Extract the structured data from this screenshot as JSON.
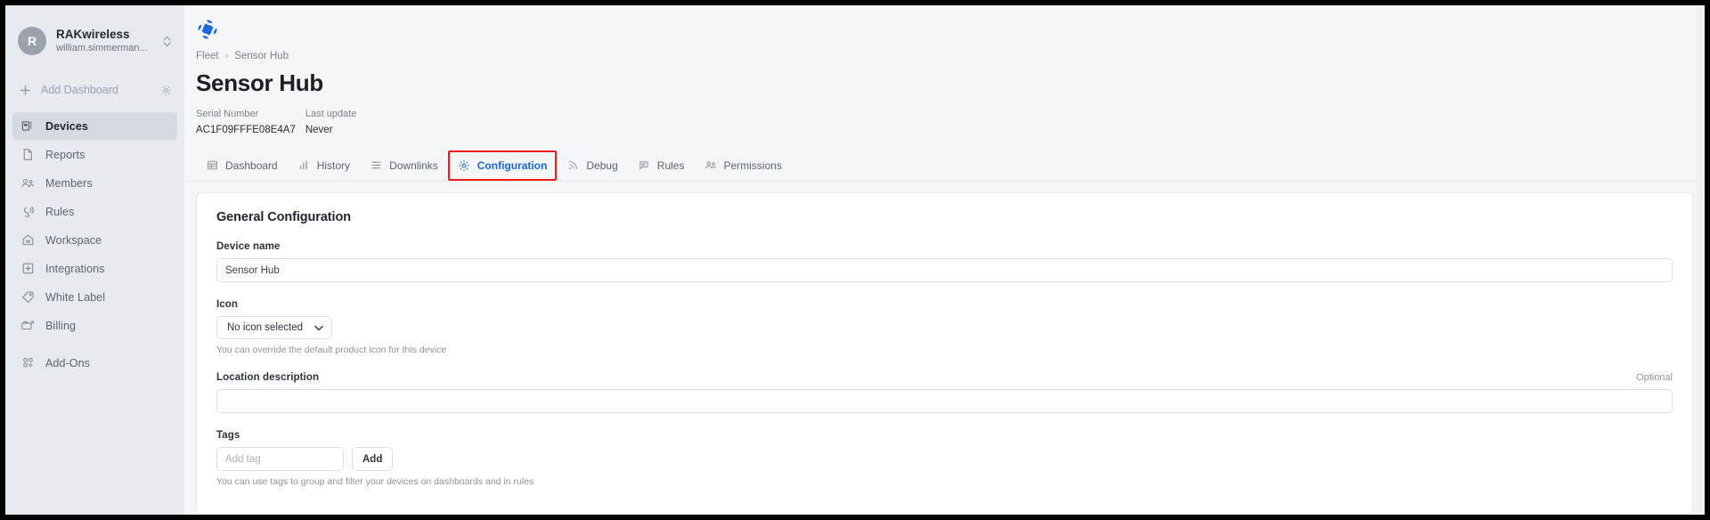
{
  "sidebar": {
    "account": {
      "avatar_initial": "R",
      "org_name": "RAKwireless",
      "user_email": "william.simmerman...",
      "switcher_icon": "chevron-up-down-icon"
    },
    "add_dashboard": {
      "label": "Add Dashboard",
      "plus_icon": "plus-icon",
      "settings_icon": "gear-icon"
    },
    "items": [
      {
        "label": "Devices",
        "icon": "devices-icon",
        "active": true
      },
      {
        "label": "Reports",
        "icon": "document-icon",
        "active": false
      },
      {
        "label": "Members",
        "icon": "users-icon",
        "active": false
      },
      {
        "label": "Rules",
        "icon": "broadcast-icon",
        "active": false
      },
      {
        "label": "Workspace",
        "icon": "home-icon",
        "active": false
      },
      {
        "label": "Integrations",
        "icon": "plus-square-icon",
        "active": false
      },
      {
        "label": "White Label",
        "icon": "tag-icon",
        "active": false
      },
      {
        "label": "Billing",
        "icon": "billing-icon",
        "active": false
      },
      {
        "label": "Add-Ons",
        "icon": "addons-icon",
        "active": false
      }
    ]
  },
  "header": {
    "logo_icon": "rakwireless-logo-icon",
    "breadcrumb": {
      "root": "Fleet",
      "separator": "›",
      "current": "Sensor Hub"
    },
    "title": "Sensor Hub",
    "meta": [
      {
        "label": "Serial Number",
        "value": "AC1F09FFFE08E4A7"
      },
      {
        "label": "Last update",
        "value": "Never"
      }
    ]
  },
  "tabs": [
    {
      "label": "Dashboard",
      "icon": "table-icon",
      "active": false,
      "highlighted": false
    },
    {
      "label": "History",
      "icon": "bar-chart-icon",
      "active": false,
      "highlighted": false
    },
    {
      "label": "Downlinks",
      "icon": "sliders-icon",
      "active": false,
      "highlighted": false
    },
    {
      "label": "Configuration",
      "icon": "gear-icon",
      "active": true,
      "highlighted": true
    },
    {
      "label": "Debug",
      "icon": "signal-icon",
      "active": false,
      "highlighted": false
    },
    {
      "label": "Rules",
      "icon": "chat-rules-icon",
      "active": false,
      "highlighted": false
    },
    {
      "label": "Permissions",
      "icon": "users-icon",
      "active": false,
      "highlighted": false
    }
  ],
  "card": {
    "title": "General Configuration",
    "device_name": {
      "label": "Device name",
      "value": "Sensor Hub",
      "placeholder": ""
    },
    "icon_field": {
      "label": "Icon",
      "selected": "No icon selected",
      "caret_icon": "chevron-down-icon",
      "hint": "You can override the default product icon for this device"
    },
    "location": {
      "label": "Location description",
      "optional_label": "Optional",
      "value": "",
      "placeholder": ""
    },
    "tags": {
      "label": "Tags",
      "input_placeholder": "Add tag",
      "input_value": "",
      "add_button": "Add",
      "hint": "You can use tags to group and filter your devices on dashboards and in rules"
    }
  },
  "colors": {
    "accent": "#1667d8",
    "highlight": "#ec1c24",
    "sidebar_bg": "#e7eaee",
    "main_bg": "#f4f5f7"
  }
}
